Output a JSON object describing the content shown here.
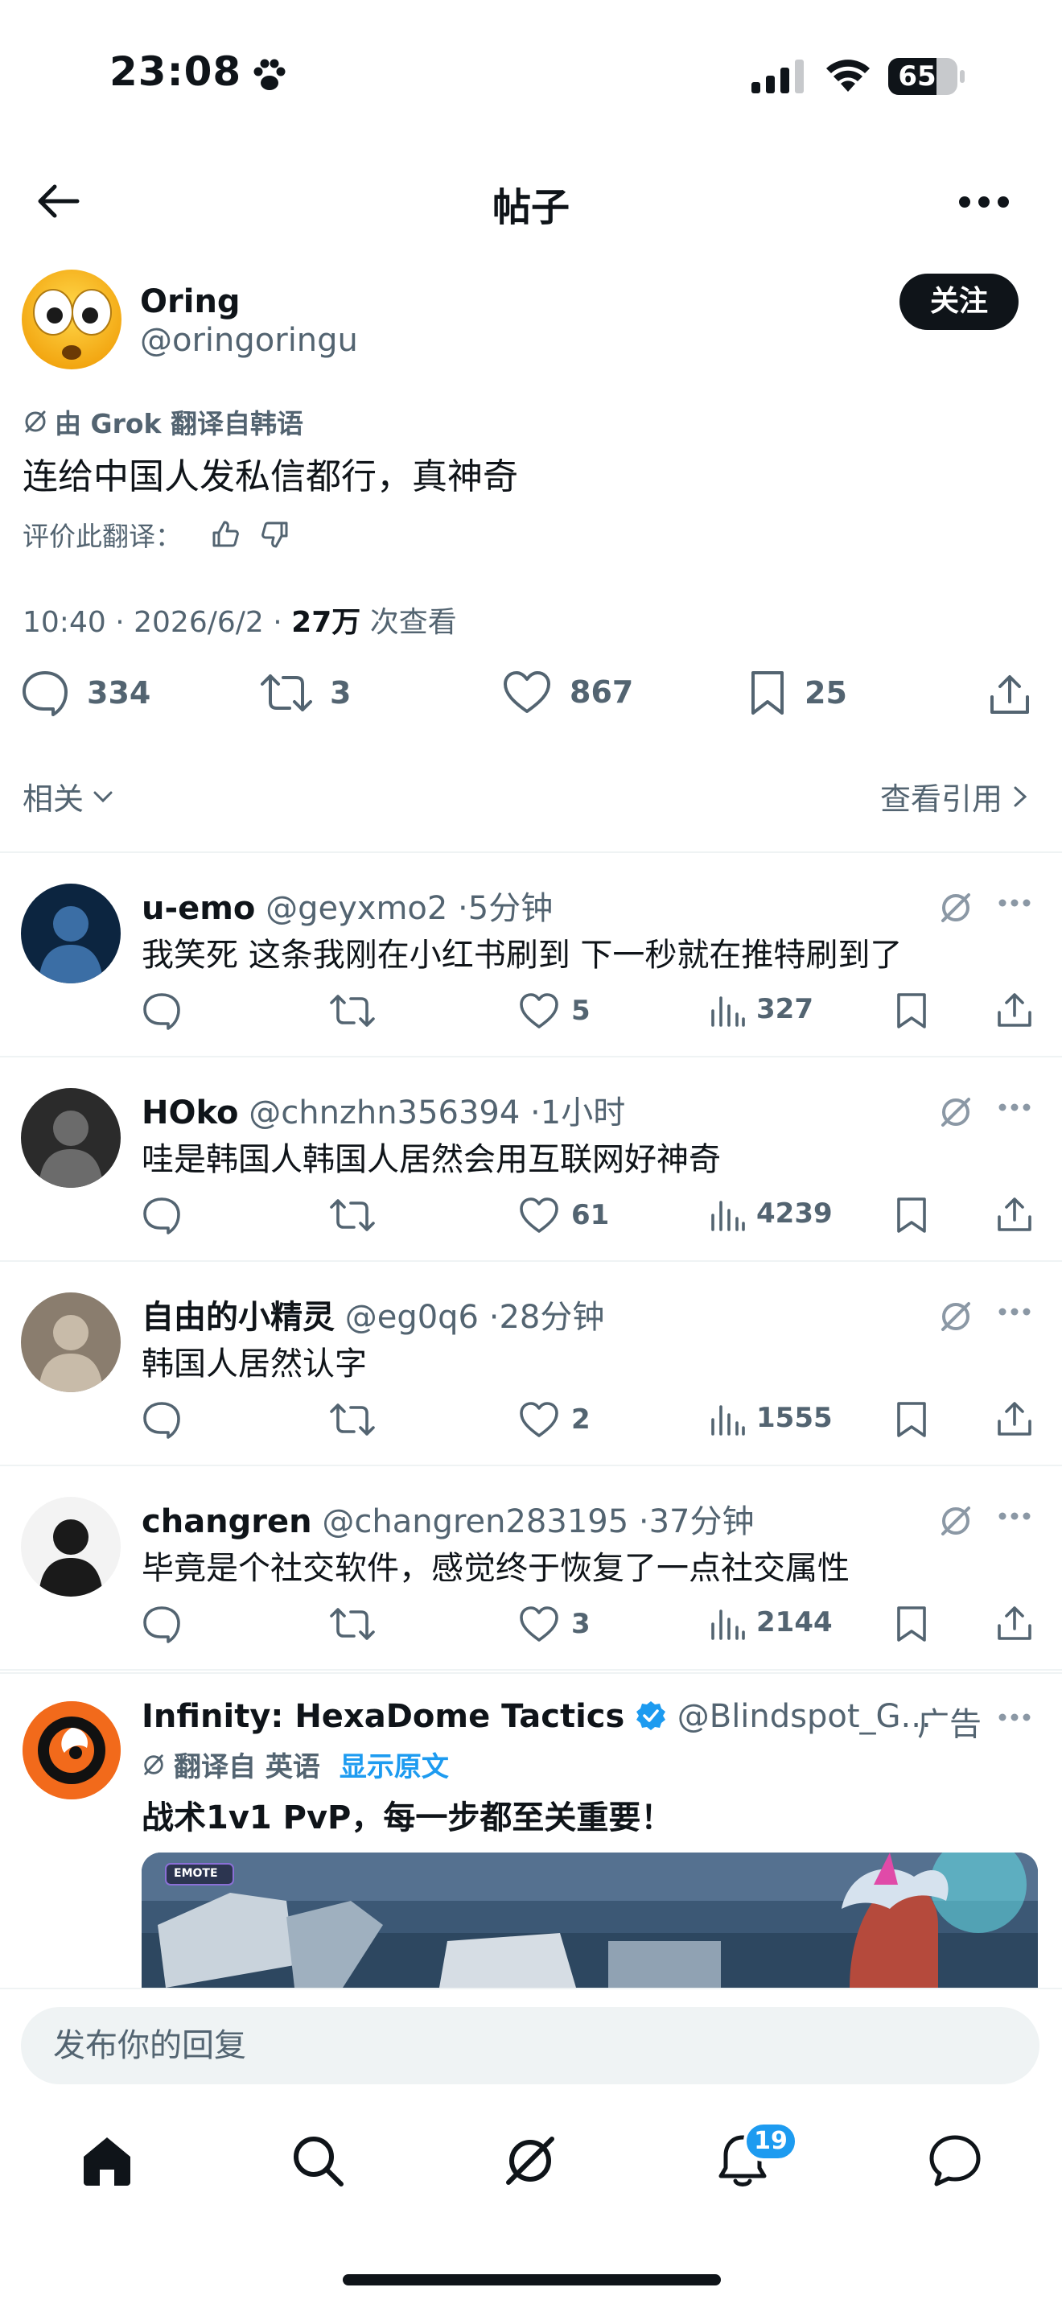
{
  "status_bar": {
    "time": "23:08",
    "battery": "65"
  },
  "header": {
    "title": "帖子"
  },
  "post": {
    "author_name": "Oring",
    "author_handle": "@oringoringu",
    "follow_label": "关注",
    "translation_note": "由 Grok 翻译自韩语",
    "text": "连给中国人发私信都行，真神奇",
    "rate_label": "评价此翻译：",
    "time": "10:40",
    "date": "2026/6/2",
    "views_count": "27万",
    "views_label": "次查看",
    "sep": "·",
    "stats": {
      "replies": "334",
      "reposts": "3",
      "likes": "867",
      "bookmarks": "25"
    },
    "related_label": "相关",
    "quotes_label": "查看引用"
  },
  "replies": [
    {
      "name": "u-emo",
      "handle": "@geyxmo2",
      "time": "5分钟",
      "text": "我笑死 这条我刚在小红书刷到 下一秒就在推特刷到了",
      "likes": "5",
      "views": "327"
    },
    {
      "name": "HOko",
      "handle": "@chnzhn356394",
      "time": "1小时",
      "text": "哇是韩国人韩国人居然会用互联网好神奇",
      "likes": "61",
      "views": "4239"
    },
    {
      "name": "自由的小精灵",
      "handle": "@eg0q6",
      "time": "28分钟",
      "text": "韩国人居然认字",
      "likes": "2",
      "views": "1555"
    },
    {
      "name": "changren",
      "handle": "@changren283195",
      "time": "37分钟",
      "text": "毕竟是个社交软件，感觉终于恢复了一点社交属性",
      "likes": "3",
      "views": "2144"
    }
  ],
  "ad": {
    "name": "Infinity: HexaDome Tactics",
    "handle": "@Blindspot_G...",
    "ad_label": "广告",
    "translated_from": "翻译自 英语",
    "show_original": "显示原文",
    "text": "战术1v1 PvP，每一步都至关重要！",
    "image_tag": "EMOTE"
  },
  "reply_box": {
    "placeholder": "发布你的回复"
  },
  "tab_bar": {
    "notification_count": "19"
  },
  "colors": {
    "accent": "#1d9bf0",
    "text": "#0f1419",
    "muted": "#536471",
    "divider": "#eff3f4"
  }
}
